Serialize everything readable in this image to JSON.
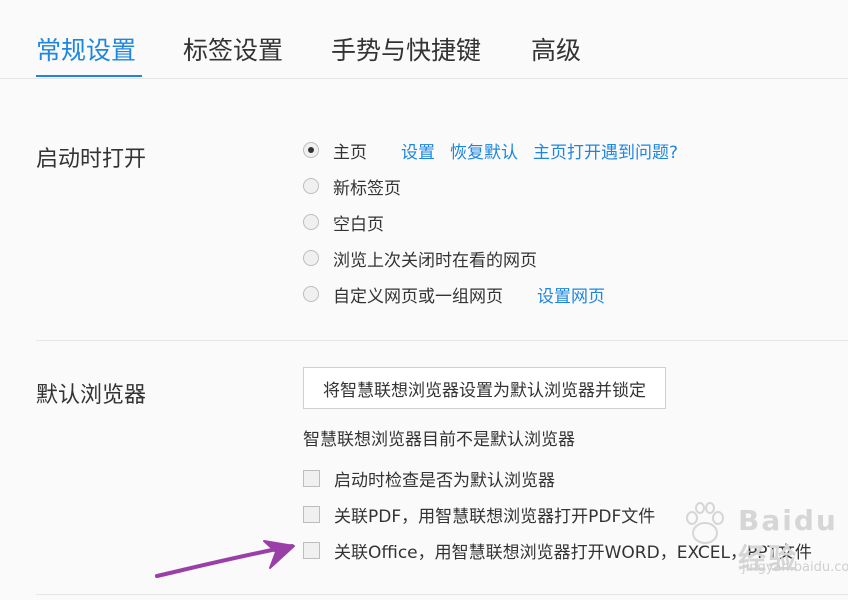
{
  "tabs": [
    {
      "label": "常规设置",
      "active": true
    },
    {
      "label": "标签设置",
      "active": false
    },
    {
      "label": "手势与快捷键",
      "active": false
    },
    {
      "label": "高级",
      "active": false
    }
  ],
  "startup": {
    "title": "启动时打开",
    "options": [
      {
        "label": "主页",
        "checked": true
      },
      {
        "label": "新标签页",
        "checked": false
      },
      {
        "label": "空白页",
        "checked": false
      },
      {
        "label": "浏览上次关闭时在看的网页",
        "checked": false
      },
      {
        "label": "自定义网页或一组网页",
        "checked": false
      }
    ],
    "homepage_links": [
      "设置",
      "恢复默认",
      "主页打开遇到问题?"
    ],
    "custom_link": "设置网页"
  },
  "default_browser": {
    "title": "默认浏览器",
    "button_label": "将智慧联想浏览器设置为默认浏览器并锁定",
    "status_text": "智慧联想浏览器目前不是默认浏览器",
    "checkboxes": [
      {
        "label": "启动时检查是否为默认浏览器",
        "checked": false
      },
      {
        "label": "关联PDF，用智慧联想浏览器打开PDF文件",
        "checked": false
      },
      {
        "label": "关联Office，用智慧联想浏览器打开WORD，EXCEL，PPT文件",
        "checked": false
      }
    ]
  },
  "annotation": {
    "arrow_color": "#9b3fa8"
  },
  "watermark": {
    "big": "Baidu 经验",
    "small": "jingyan.baidu.com"
  },
  "colors": {
    "accent": "#1f86e0",
    "text": "#333333",
    "background": "#fafafa"
  }
}
